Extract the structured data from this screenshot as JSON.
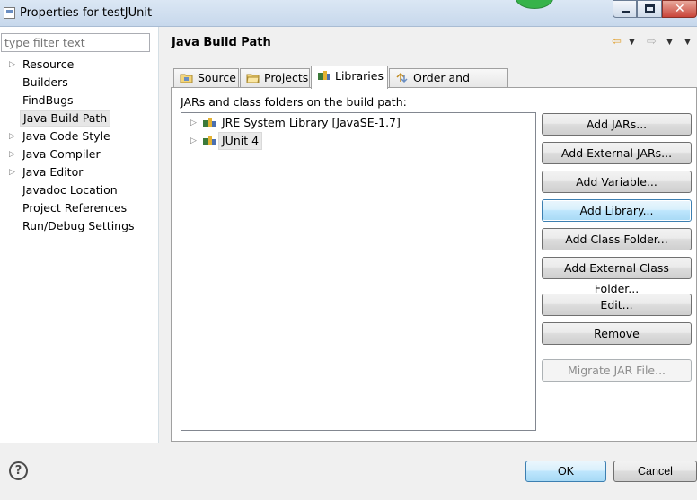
{
  "window": {
    "title": "Properties for testJUnit"
  },
  "left": {
    "filter_placeholder": "type filter text",
    "items": [
      {
        "label": "Resource",
        "expandable": true,
        "selected": false
      },
      {
        "label": "Builders",
        "expandable": false,
        "selected": false
      },
      {
        "label": "FindBugs",
        "expandable": false,
        "selected": false
      },
      {
        "label": "Java Build Path",
        "expandable": false,
        "selected": true
      },
      {
        "label": "Java Code Style",
        "expandable": true,
        "selected": false
      },
      {
        "label": "Java Compiler",
        "expandable": true,
        "selected": false
      },
      {
        "label": "Java Editor",
        "expandable": true,
        "selected": false
      },
      {
        "label": "Javadoc Location",
        "expandable": false,
        "selected": false
      },
      {
        "label": "Project References",
        "expandable": false,
        "selected": false
      },
      {
        "label": "Run/Debug Settings",
        "expandable": false,
        "selected": false
      }
    ]
  },
  "main": {
    "title": "Java Build Path",
    "tabs": [
      {
        "label": "Source",
        "icon": "source-folder-icon"
      },
      {
        "label": "Projects",
        "icon": "projects-folder-icon"
      },
      {
        "label": "Libraries",
        "icon": "libraries-icon"
      },
      {
        "label": "Order and Export",
        "icon": "order-export-icon"
      }
    ],
    "active_tab": "Libraries",
    "classpath_label": "JARs and class folders on the build path:",
    "libraries": [
      {
        "label": "JRE System Library [JavaSE-1.7]"
      },
      {
        "label": "JUnit 4"
      }
    ],
    "buttons": {
      "add_jars": "Add JARs...",
      "add_external_jars": "Add External JARs...",
      "add_variable": "Add Variable...",
      "add_library": "Add Library...",
      "add_class_folder": "Add Class Folder...",
      "add_external_class_folder": "Add External Class Folder...",
      "edit": "Edit...",
      "remove": "Remove",
      "migrate_jar": "Migrate JAR File..."
    }
  },
  "footer": {
    "help_glyph": "?",
    "ok": "OK",
    "cancel": "Cancel"
  },
  "colors": {
    "title_bar": "#c7d8ec",
    "selection": "#e6e6e6",
    "focus_border": "#3c7fb1",
    "close_button": "#c9453a"
  }
}
